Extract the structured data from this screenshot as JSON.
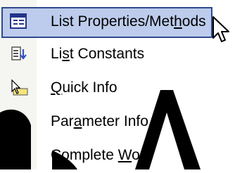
{
  "menu": {
    "items": [
      {
        "label_pre": "List Properties/Met",
        "label_key": "h",
        "label_post": "ods",
        "icon": "list-properties-icon",
        "highlighted": true
      },
      {
        "label_pre": "Li",
        "label_key": "s",
        "label_post": "t Constants",
        "icon": "list-constants-icon",
        "highlighted": false
      },
      {
        "label_pre": "",
        "label_key": "Q",
        "label_post": "uick Info",
        "icon": "quick-info-icon",
        "highlighted": false
      },
      {
        "label_pre": "Par",
        "label_key": "a",
        "label_post": "meter Info",
        "icon": "parameter-info-icon",
        "highlighted": false
      },
      {
        "label_pre": "Complete ",
        "label_key": "W",
        "label_post": "ord",
        "icon": "complete-word-icon",
        "highlighted": false
      }
    ]
  },
  "colors": {
    "highlight_fill": "#bdccec",
    "highlight_border": "#2e4a8e",
    "gutter": "#f5f5f1"
  },
  "cursor": {
    "icon": "arrow-cursor-icon"
  }
}
